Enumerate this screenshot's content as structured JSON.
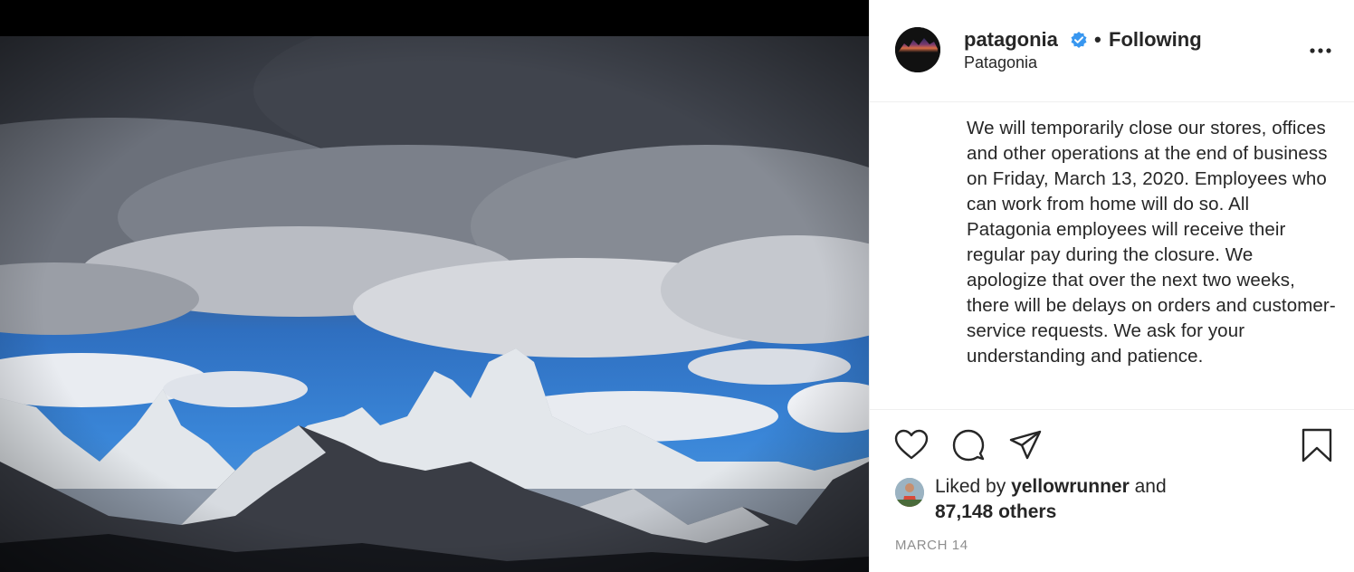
{
  "post": {
    "header": {
      "username": "patagonia",
      "follow_separator": "•",
      "follow_state": "Following",
      "location": "Patagonia",
      "avatar_logo_text": "patagonia",
      "more_icon": "more-horizontal-icon"
    },
    "caption": "We will temporarily close our stores, offices and other operations at the end of business on Friday, March 13, 2020. Employees who can work from home will do so. All Patagonia employees will receive their regular pay during the closure. We apologize that over the next two weeks, there will be delays on orders and customer-service requests. We ask for your understanding and patience.",
    "actions": {
      "like_icon": "heart-icon",
      "comment_icon": "comment-icon",
      "share_icon": "paper-plane-icon",
      "save_icon": "bookmark-icon"
    },
    "likes": {
      "prefix": "Liked by",
      "user": "yellowrunner",
      "conjunction": "and",
      "others": "87,148 others"
    },
    "date": "MARCH 14"
  },
  "colors": {
    "text": "#262626",
    "muted": "#8e8e8e",
    "verified": "#3897f0",
    "divider": "#efefef"
  }
}
